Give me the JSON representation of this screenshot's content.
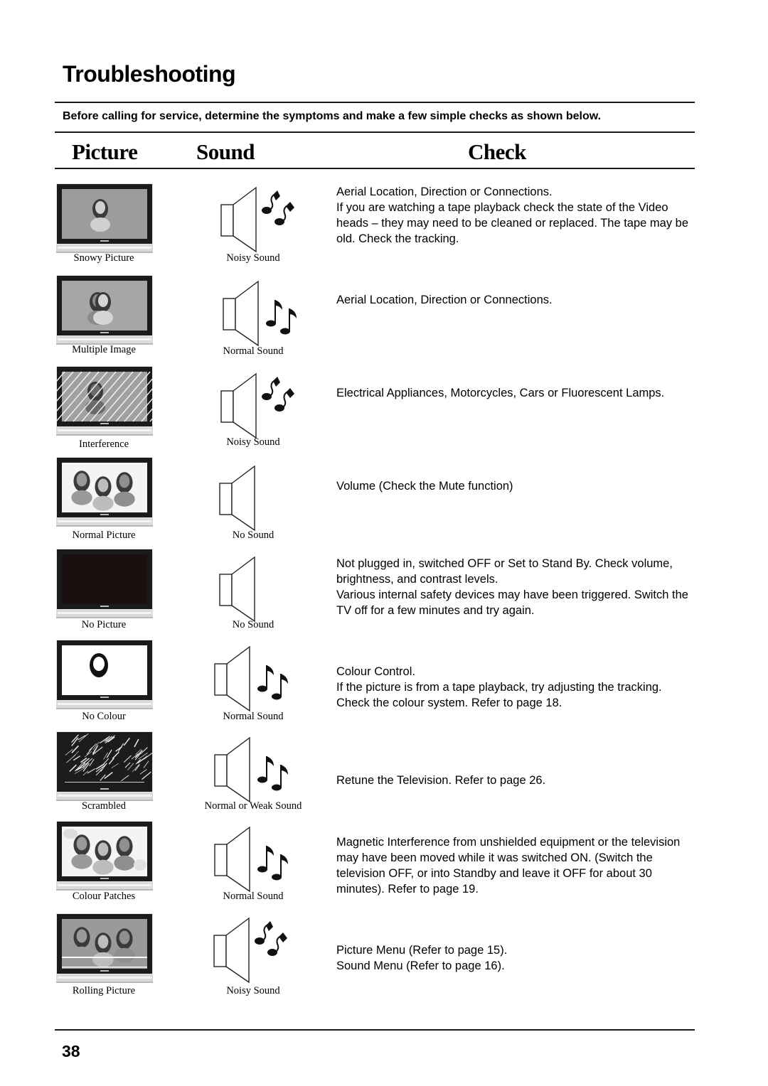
{
  "title": "Troubleshooting",
  "intro": "Before calling for service, determine the symptoms and make a few simple checks as shown below.",
  "columns": {
    "picture": "Picture",
    "sound": "Sound",
    "check": "Check"
  },
  "rows": [
    {
      "picture": "Snowy Picture",
      "picture_icon": "tv-snowy-picture-icon",
      "sound": "Noisy Sound",
      "sound_icon": "speaker-noisy-icon",
      "check": [
        "Aerial Location, Direction or Connections.",
        "If you are watching a tape playback check the state of the Video heads – they may need to be cleaned or replaced. The tape may be old. Check the tracking."
      ]
    },
    {
      "picture": "Multiple Image",
      "picture_icon": "tv-multiple-image-icon",
      "sound": "Normal Sound",
      "sound_icon": "speaker-normal-icon",
      "check": [
        "Aerial Location, Direction or Connections."
      ]
    },
    {
      "picture": "Interference",
      "picture_icon": "tv-interference-icon",
      "sound": "Noisy Sound",
      "sound_icon": "speaker-noisy-icon",
      "check": [
        "Electrical Appliances, Motorcycles, Cars or Fluorescent Lamps."
      ]
    },
    {
      "picture": "Normal Picture",
      "picture_icon": "tv-normal-picture-icon",
      "sound": "No Sound",
      "sound_icon": "speaker-silent-icon",
      "check": [
        "Volume (Check the Mute function)"
      ]
    },
    {
      "picture": "No Picture",
      "picture_icon": "tv-no-picture-icon",
      "sound": "No Sound",
      "sound_icon": "speaker-silent-icon",
      "check": [
        "Not plugged in, switched OFF or Set to Stand By. Check volume, brightness, and contrast levels.",
        "Various internal safety devices may have been triggered. Switch the TV off for a few minutes and try again."
      ]
    },
    {
      "picture": "No Colour",
      "picture_icon": "tv-no-colour-icon",
      "sound": "Normal Sound",
      "sound_icon": "speaker-normal-icon",
      "check": [
        "Colour Control.",
        "If the picture is from a tape playback, try adjusting the tracking.",
        "Check the colour system. Refer to page 18."
      ]
    },
    {
      "picture": "Scrambled",
      "picture_icon": "tv-scrambled-icon",
      "sound": "Normal or Weak Sound",
      "sound_icon": "speaker-normal-icon",
      "check": [
        "Retune the Television. Refer to page 26."
      ]
    },
    {
      "picture": "Colour Patches",
      "picture_icon": "tv-colour-patches-icon",
      "sound": "Normal Sound",
      "sound_icon": "speaker-normal-icon",
      "check": [
        "Magnetic Interference from unshielded equipment or the television may have been moved while it was switched ON. (Switch the television OFF, or into Standby and leave it OFF for about 30 minutes). Refer to page 19."
      ]
    },
    {
      "picture": "Rolling Picture",
      "picture_icon": "tv-rolling-picture-icon",
      "sound": "Noisy Sound",
      "sound_icon": "speaker-noisy-icon",
      "check": [
        "Picture Menu (Refer to page 15).",
        "Sound Menu (Refer to page 16)."
      ]
    }
  ],
  "page_number": "38"
}
